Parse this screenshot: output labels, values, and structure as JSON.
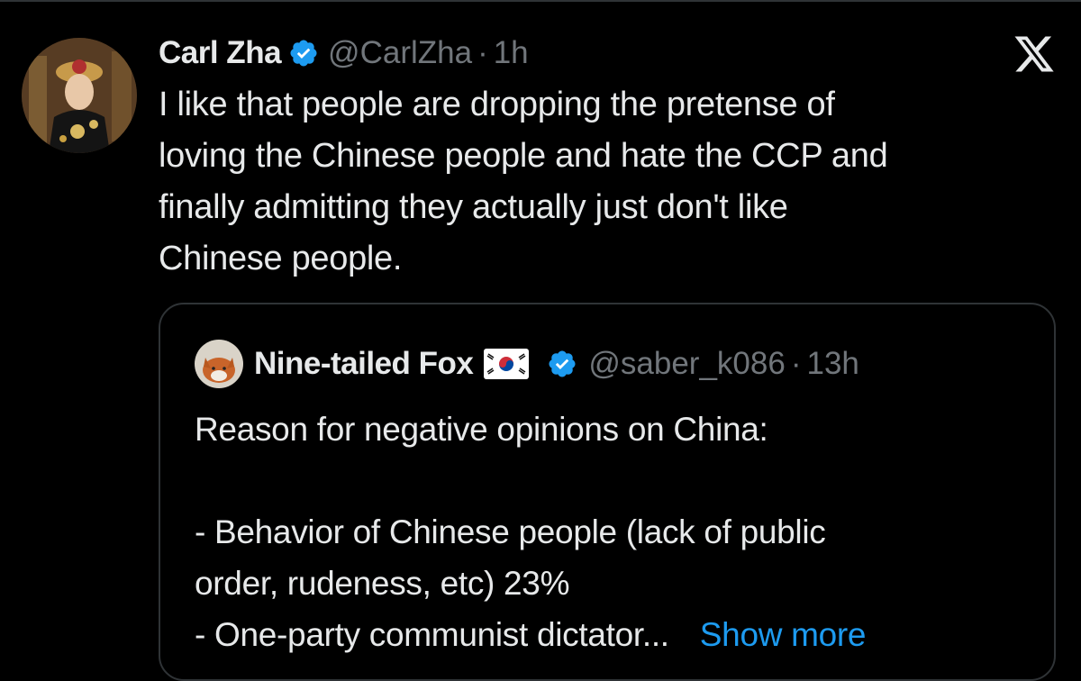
{
  "tweet": {
    "display_name": "Carl Zha",
    "handle": "@CarlZha",
    "separator": "·",
    "time": "1h",
    "lines": [
      "I like that people are dropping the pretense of",
      "loving the Chinese people and hate the CCP and",
      "finally admitting they actually just don't like",
      "Chinese people."
    ]
  },
  "quote": {
    "display_name": "Nine-tailed Fox",
    "handle": "@saber_k086",
    "separator": "·",
    "time": "13h",
    "line1": "Reason for negative opinions on China:",
    "line2": "- Behavior of Chinese people (lack of public",
    "line3": "order, rudeness, etc) 23%",
    "line4": "- One-party communist dictator...",
    "show_more": "Show more"
  },
  "icons": {
    "verified": "verified-badge-icon",
    "close": "x-logo-icon",
    "flag": "south-korea-flag-icon"
  },
  "colors": {
    "background": "#000000",
    "text": "#e7e9ea",
    "muted": "#71767b",
    "accent": "#1d9bf0",
    "border": "#2f3336"
  }
}
